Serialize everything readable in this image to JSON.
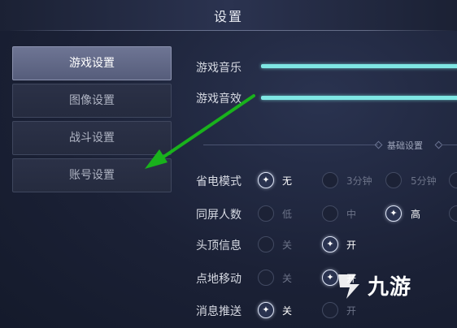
{
  "header": {
    "title": "设置"
  },
  "sidebar": {
    "items": [
      {
        "label": "游戏设置",
        "active": true
      },
      {
        "label": "图像设置",
        "active": false
      },
      {
        "label": "战斗设置",
        "active": false
      },
      {
        "label": "账号设置",
        "active": false
      }
    ]
  },
  "sliders": [
    {
      "label": "游戏音乐"
    },
    {
      "label": "游戏音效"
    }
  ],
  "section": {
    "title": "基础设置"
  },
  "settings": [
    {
      "label": "省电模式",
      "options": [
        "无",
        "3分钟",
        "5分钟"
      ],
      "selected": 0
    },
    {
      "label": "同屏人数",
      "options": [
        "低",
        "中",
        "高"
      ],
      "selected": 2
    },
    {
      "label": "头顶信息",
      "options": [
        "关",
        "开"
      ],
      "selected": 1
    },
    {
      "label": "点地移动",
      "options": [
        "关",
        "开"
      ],
      "selected": 1
    },
    {
      "label": "消息推送",
      "options": [
        "关",
        "开"
      ],
      "selected": 0
    }
  ],
  "watermark": {
    "text": "九游"
  },
  "colors": {
    "accent": "#7fe7e4",
    "arrow": "#19b21c",
    "active_tab": "#626a89"
  }
}
